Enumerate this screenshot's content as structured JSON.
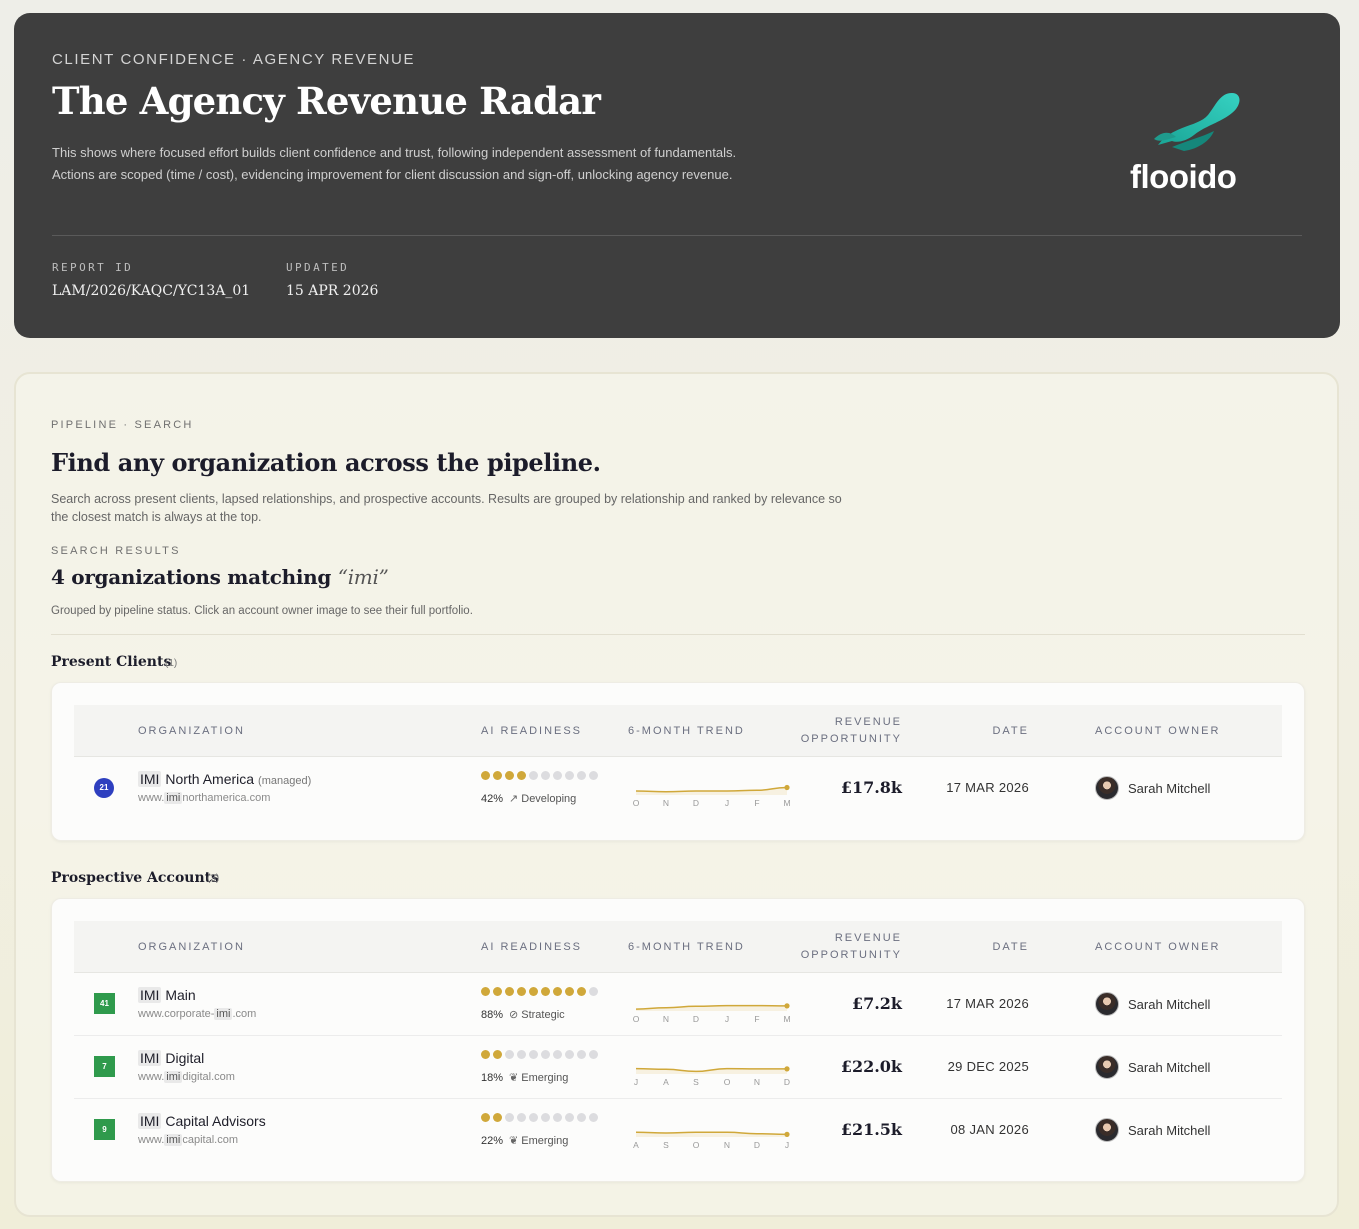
{
  "header": {
    "eyebrow": "CLIENT CONFIDENCE · AGENCY REVENUE",
    "title": "The Agency Revenue Radar",
    "description": "This shows where focused effort builds client confidence and trust, following independent assessment of fundamentals. Actions are scoped (time / cost), evidencing improvement for client discussion and sign-off, unlocking agency revenue.",
    "report_id_label": "REPORT ID",
    "report_id": "LAM/2026/KAQC/YC13A_01",
    "updated_label": "UPDATED",
    "updated": "15 APR 2026",
    "logo_text": "flooido",
    "logo_color": "#2fc1b0"
  },
  "search": {
    "eyebrow": "PIPELINE · SEARCH",
    "title": "Find any organization across the pipeline.",
    "description": "Search across present clients, lapsed relationships, and prospective accounts. Results are grouped by relationship and ranked by relevance so the closest match is always at the top.",
    "results_label": "SEARCH RESULTS",
    "results_count_text": "4 organizations matching",
    "query": "“imi”",
    "results_note": "Grouped by pipeline status. Click an account owner image to see their full portfolio."
  },
  "columns": {
    "organization": "ORGANIZATION",
    "ai_readiness": "AI READINESS",
    "trend": "6-MONTH TREND",
    "revenue_1": "REVENUE",
    "revenue_2": "OPPORTUNITY",
    "date": "DATE",
    "owner": "ACCOUNT OWNER"
  },
  "groups": [
    {
      "title": "Present Clients",
      "count": "(1)",
      "rows": [
        {
          "badge": "21",
          "badge_shape": "round",
          "name_hl": "IMI",
          "name_rest": " North America",
          "tag": "(managed)",
          "url_pre": "www.",
          "url_hl": "imi",
          "url_post": "northamerica.com",
          "readiness_pct": "42%",
          "readiness_dots": 4,
          "readiness_label": "Developing",
          "readiness_icon": "trending-up-icon",
          "trend_months": [
            "O",
            "N",
            "D",
            "J",
            "F",
            "M"
          ],
          "trend_values": [
            0.5,
            0.45,
            0.5,
            0.5,
            0.55,
            0.75
          ],
          "revenue": "£17.8k",
          "date": "17 MAR 2026",
          "owner": "Sarah Mitchell"
        }
      ]
    },
    {
      "title": "Prospective Accounts",
      "count": "(3)",
      "rows": [
        {
          "badge": "41",
          "badge_shape": "square",
          "name_hl": "IMI",
          "name_rest": " Main",
          "tag": "",
          "url_pre": "www.corporate-",
          "url_hl": "imi",
          "url_post": ".com",
          "readiness_pct": "88%",
          "readiness_dots": 9,
          "readiness_label": "Strategic",
          "readiness_icon": "compass-icon",
          "trend_months": [
            "O",
            "N",
            "D",
            "J",
            "F",
            "M"
          ],
          "trend_values": [
            0.35,
            0.45,
            0.55,
            0.6,
            0.6,
            0.58
          ],
          "revenue": "£7.2k",
          "date": "17 MAR 2026",
          "owner": "Sarah Mitchell"
        },
        {
          "badge": "7",
          "badge_shape": "square",
          "name_hl": "IMI",
          "name_rest": " Digital",
          "tag": "",
          "url_pre": "www.",
          "url_hl": "imi",
          "url_post": "digital.com",
          "readiness_pct": "18%",
          "readiness_dots": 2,
          "readiness_label": "Emerging",
          "readiness_icon": "leaf-icon",
          "trend_months": [
            "J",
            "A",
            "S",
            "O",
            "N",
            "D"
          ],
          "trend_values": [
            0.6,
            0.55,
            0.4,
            0.6,
            0.58,
            0.58
          ],
          "revenue": "£22.0k",
          "date": "29 DEC 2025",
          "owner": "Sarah Mitchell"
        },
        {
          "badge": "9",
          "badge_shape": "square",
          "name_hl": "IMI",
          "name_rest": " Capital Advisors",
          "tag": "",
          "url_pre": "www.",
          "url_hl": "imi",
          "url_post": "capital.com",
          "readiness_pct": "22%",
          "readiness_dots": 2,
          "readiness_label": "Emerging",
          "readiness_icon": "leaf-icon",
          "trend_months": [
            "A",
            "S",
            "O",
            "N",
            "D",
            "J"
          ],
          "trend_values": [
            0.55,
            0.5,
            0.55,
            0.55,
            0.45,
            0.4
          ],
          "revenue": "£21.5k",
          "date": "08 JAN 2026",
          "owner": "Sarah Mitchell"
        }
      ]
    }
  ]
}
